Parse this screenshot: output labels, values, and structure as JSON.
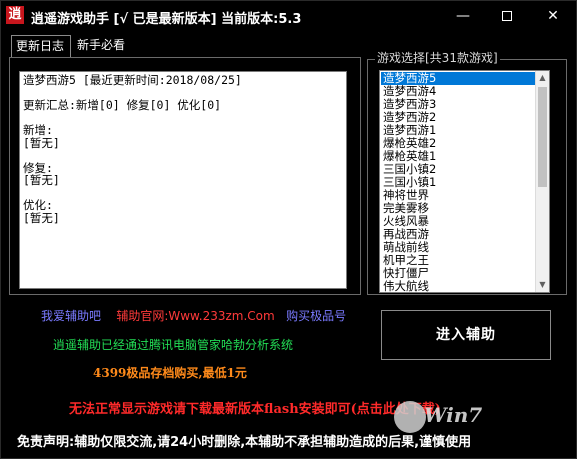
{
  "window": {
    "icon_text": "逍",
    "title": "逍遥游戏助手 [√ 已是最新版本] 当前版本:5.3",
    "controls": {
      "minimize": "—",
      "close": "✕"
    }
  },
  "tabs": [
    {
      "label": "更新日志",
      "active": true
    },
    {
      "label": "新手必看",
      "active": false
    }
  ],
  "log": {
    "text": "造梦西游5 [最近更新时间:2018/08/25]\n\n更新汇总:新增[0] 修复[0] 优化[0]\n\n新增:\n[暂无]\n\n修复:\n[暂无]\n\n优化:\n[暂无]"
  },
  "game_select": {
    "legend": "游戏选择[共31款游戏]",
    "items": [
      "造梦西游5",
      "造梦西游4",
      "造梦西游3",
      "造梦西游2",
      "造梦西游1",
      "爆枪英雄2",
      "爆枪英雄1",
      "三国小镇2",
      "三国小镇1",
      "神将世界",
      "完美雾移",
      "火线风暴",
      "再战西游",
      "萌战前线",
      "机甲之王",
      "快打僵尸",
      "伟大航线"
    ],
    "selected_index": 0
  },
  "enter_button": {
    "label": "进入辅助"
  },
  "info": {
    "love_link": "我爱辅助吧",
    "official_site": "辅助官网:Www.233zm.Com",
    "buy_item": "购买极品号",
    "security_note": "逍遥辅助已经通过腾讯电脑管家哈勃分析系统",
    "promo": "4399极品存档购买,最低1元",
    "flash_notice": "无法正常显示游戏请下载最新版本flash安装即可(点击此处下载)",
    "disclaimer": "免责声明:辅助仅限交流,请24小时删除,本辅助不承担辅助造成的后果,谨慎使用"
  },
  "watermark": {
    "text": "Win7"
  },
  "colors": {
    "background": "#000000",
    "selection": "#0078d7",
    "purple_link": "#7a7aff",
    "red_text": "#ff2a2a",
    "green_text": "#22dd55",
    "orange_text": "#ff8a1a"
  }
}
